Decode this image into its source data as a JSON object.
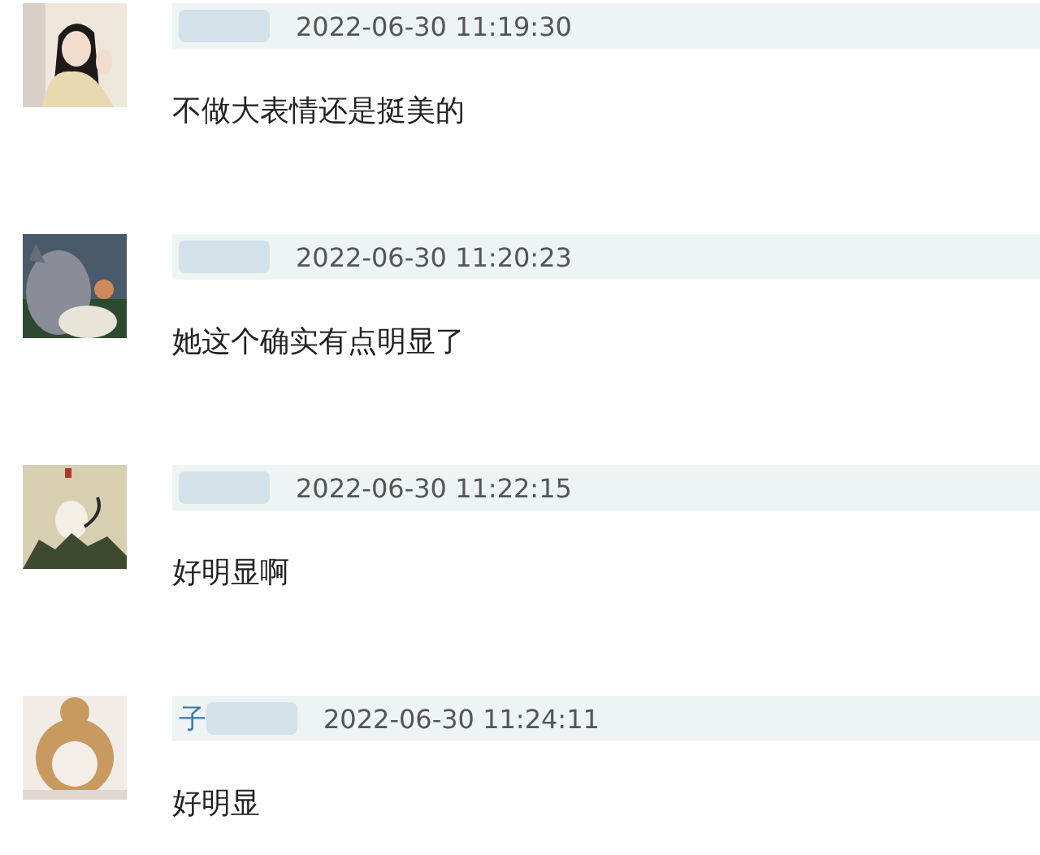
{
  "comments": [
    {
      "time": "2022-06-30 11:19:30",
      "text": "不做大表情还是挺美的"
    },
    {
      "time": "2022-06-30 11:20:23",
      "text": "她这个确实有点明显了"
    },
    {
      "time": "2022-06-30 11:22:15",
      "text": "好明显啊"
    },
    {
      "username_visible": "子",
      "time": "2022-06-30 11:24:11",
      "text": "好明显"
    }
  ]
}
